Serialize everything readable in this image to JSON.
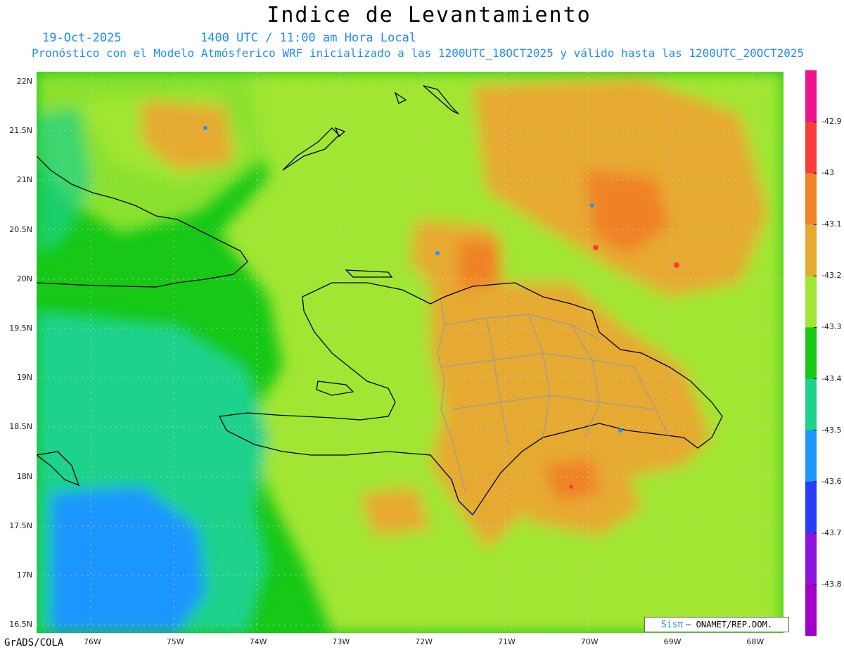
{
  "header": {
    "title": "Indice de Levantamiento",
    "date": "19-Oct-2025",
    "time": "1400 UTC / 11:00 am Hora Local",
    "forecast_text": "Pronóstico con el Modelo Atmósferico WRF inicializado a las 1200UTC_18OCT2025 y válido hasta las  1200UTC_20OCT2025"
  },
  "map": {
    "lat_labels": [
      "22N",
      "21.5N",
      "21N",
      "20.5N",
      "20N",
      "19.5N",
      "19N",
      "18.5N",
      "18N",
      "17.5N",
      "17N",
      "16.5N"
    ],
    "lon_labels": [
      "76W",
      "75W",
      "74W",
      "73W",
      "72W",
      "71W",
      "70W",
      "69W",
      "68W"
    ],
    "background_color": "#3cb83c",
    "field_colors": {
      "dark_green": "#17c817",
      "light_green": "#a0e632",
      "orange": "#e6aa32",
      "dark_orange": "#f08228",
      "teal": "#1ed28c",
      "blue": "#1e96ff"
    }
  },
  "colorbar": {
    "labels": [
      "-42.9",
      "-43",
      "-43.1",
      "-43.2",
      "-43.3",
      "-43.4",
      "-43.5",
      "-43.6",
      "-43.7",
      "-43.8"
    ],
    "colors": [
      "#f0148c",
      "#fa3c3c",
      "#f08228",
      "#e6aa32",
      "#a0e632",
      "#17c817",
      "#1ed28c",
      "#1e96ff",
      "#283cff",
      "#8c14dc",
      "#a000c8"
    ]
  },
  "credit": {
    "brand": "Sisπ",
    "text": "– ONAMET/REP.DOM."
  },
  "footer": "GrADS/COLA"
}
